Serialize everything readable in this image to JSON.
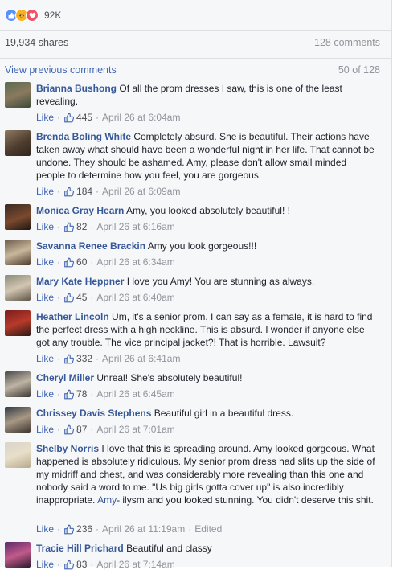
{
  "reactions": {
    "count": "92K",
    "types": [
      "like",
      "angry",
      "love"
    ],
    "colors": {
      "like": "#5890ff",
      "angry": "#f7b125",
      "love": "#f25268"
    }
  },
  "stats": {
    "shares": "19,934 shares",
    "comments": "128 comments"
  },
  "pagination": {
    "view_previous": "View previous comments",
    "position": "50 of 128"
  },
  "actions": {
    "like_label": "Like",
    "edited_label": "Edited"
  },
  "comments": [
    {
      "author": "Brianna Bushong",
      "text": "Of all the prom dresses I saw, this is one of the least revealing.",
      "likes": "445",
      "time": "April 26 at 6:04am"
    },
    {
      "author": "Brenda Boling White",
      "text": "Completely absurd. She is beautiful. Their actions have taken away what should have been a wonderful night in her life. That cannot be undone. They should be ashamed. Amy, please don't allow small minded people to determine how you feel, you are gorgeous.",
      "likes": "184",
      "time": "April 26 at 6:09am"
    },
    {
      "author": "Monica Gray Hearn",
      "text": "Amy, you looked absolutely beautiful! !",
      "likes": "82",
      "time": "April 26 at 6:16am"
    },
    {
      "author": "Savanna Renee Brackin",
      "text": "Amy you look gorgeous!!!",
      "likes": "60",
      "time": "April 26 at 6:34am"
    },
    {
      "author": "Mary Kate Heppner",
      "text": "I love you Amy! You are stunning as always.",
      "likes": "45",
      "time": "April 26 at 6:40am"
    },
    {
      "author": "Heather Lincoln",
      "text": "Um, it's a senior prom. I can say as a female, it is hard to find the perfect dress with a high neckline. This is absurd. I wonder if anyone else got any trouble. The vice principal jacket?! That is horrible. Lawsuit?",
      "likes": "332",
      "time": "April 26 at 6:41am"
    },
    {
      "author": "Cheryl Miller",
      "text": "Unreal! She's absolutely beautiful!",
      "likes": "78",
      "time": "April 26 at 6:45am"
    },
    {
      "author": "Chrissey Davis Stephens",
      "text": "Beautiful girl in a beautiful dress.",
      "likes": "87",
      "time": "April 26 at 7:01am"
    },
    {
      "author": "Shelby Norris",
      "text": "I love that this is spreading around. Amy looked gorgeous. What happened is absolutely ridiculous. My senior prom dress had slits up the side of my midriff and chest, and was considerably more revealing than this one and nobody said a word to me. \"Us big girls gotta cover up\" is also incredibly inappropriate.",
      "mention": "Amy",
      "text_after": "- ilysm and you looked stunning. You didn't deserve this shit.",
      "likes": "236",
      "time": "April 26 at 11:19am"
    },
    {
      "author": "Tracie Hill Prichard",
      "text": "Beautiful and classy",
      "likes": "83",
      "time": "April 26 at 7:14am"
    }
  ]
}
